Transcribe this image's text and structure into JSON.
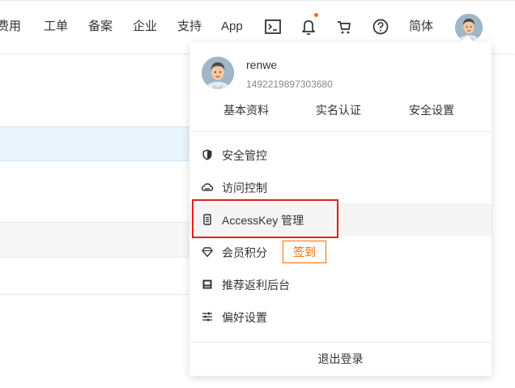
{
  "topbar": {
    "items": [
      "费用",
      "工单",
      "备案",
      "企业",
      "支持",
      "App"
    ],
    "language": "简体",
    "icons": [
      "terminal-icon",
      "bell-icon",
      "cart-icon",
      "help-icon",
      "avatar"
    ]
  },
  "account_menu": {
    "username": "renwe",
    "uid": "1492219897303680",
    "links": [
      "基本资料",
      "实名认证",
      "安全设置"
    ],
    "items": [
      {
        "label": "安全管控",
        "icon": "shield-icon"
      },
      {
        "label": "访问控制",
        "icon": "cloud-icon"
      },
      {
        "label": "AccessKey 管理",
        "icon": "key-icon"
      },
      {
        "label": "会员积分",
        "icon": "diamond-icon",
        "badge": "签到"
      },
      {
        "label": "推荐返利后台",
        "icon": "gift-icon"
      },
      {
        "label": "偏好设置",
        "icon": "sliders-icon"
      }
    ],
    "logout": "退出登录"
  },
  "colors": {
    "accent": "#ff6a00",
    "highlight_box": "#e0201b",
    "row_highlight": "#eaf4fd"
  }
}
